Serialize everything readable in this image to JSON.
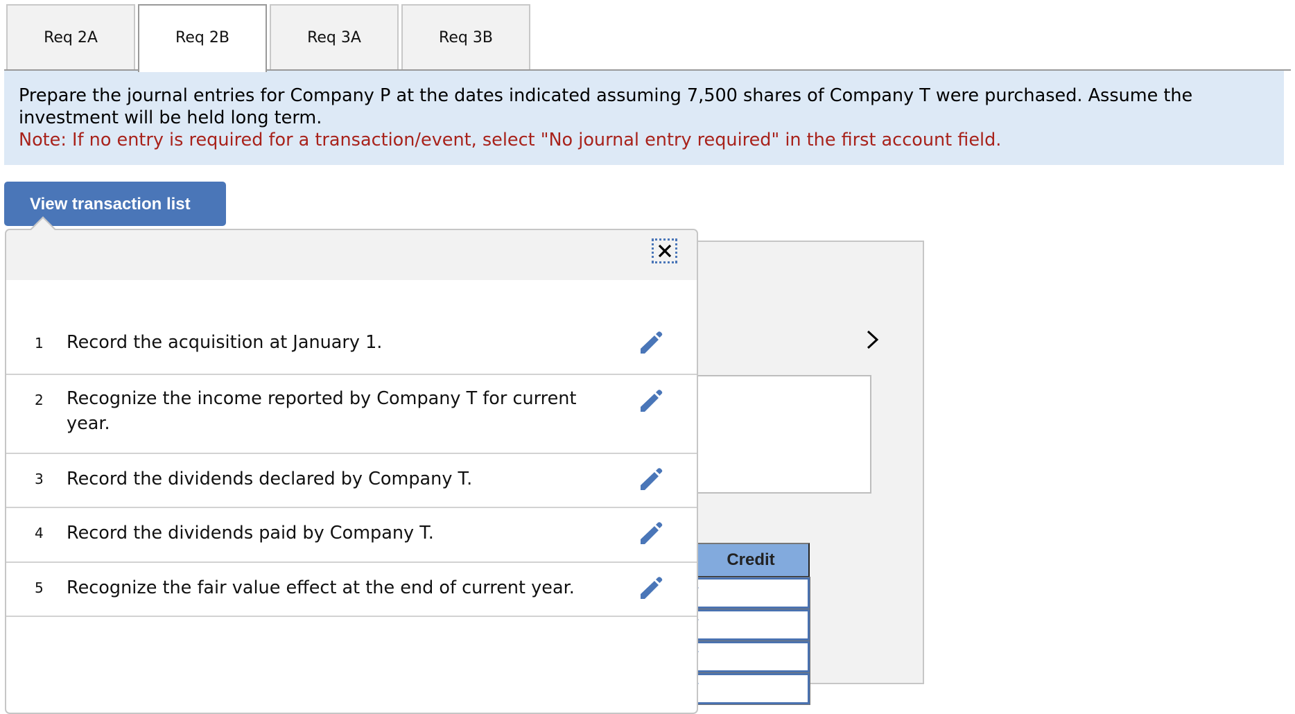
{
  "tabs": [
    {
      "label": "Req 2A",
      "active": false
    },
    {
      "label": "Req 2B",
      "active": true
    },
    {
      "label": "Req 3A",
      "active": false
    },
    {
      "label": "Req 3B",
      "active": false
    }
  ],
  "instructions": {
    "text": "Prepare the journal entries for Company P at the dates indicated assuming 7,500 shares of Company T were purchased. Assume the investment will be held long term.",
    "note": "Note: If no entry is required for a transaction/event, select \"No journal entry required\" in the first account field."
  },
  "view_transaction_button": "View transaction list",
  "colors": {
    "accent": "#4a76b8",
    "instruction_bg": "#dde9f6",
    "note_text": "#a8221b",
    "credit_header_bg": "#82aadd"
  },
  "transaction_popup": {
    "close_icon": "close-icon",
    "edit_icon": "pencil-icon",
    "transactions": [
      {
        "number": "1",
        "description": "Record the acquisition at January 1."
      },
      {
        "number": "2",
        "description": "Recognize the income reported by Company T for current year."
      },
      {
        "number": "3",
        "description": "Record the dividends declared by Company T."
      },
      {
        "number": "4",
        "description": "Record the dividends paid by Company T."
      },
      {
        "number": "5",
        "description": "Recognize the fair value effect at the end of current year."
      }
    ]
  },
  "journal_panel": {
    "next_icon": "chevron-right-icon",
    "credit_header": "Credit",
    "credit_values": [
      "",
      "",
      "",
      ""
    ]
  }
}
